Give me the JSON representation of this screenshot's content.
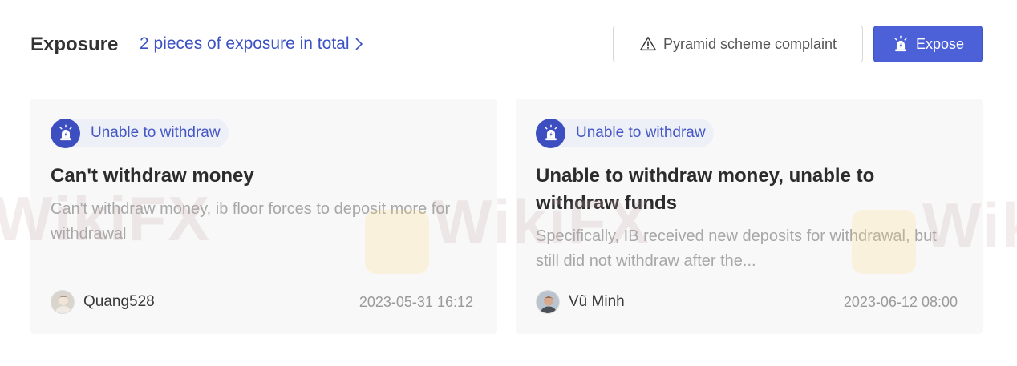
{
  "header": {
    "title": "Exposure",
    "total_link": "2 pieces of exposure in total",
    "complaint_button": "Pyramid scheme complaint",
    "expose_button": "Expose"
  },
  "watermark": {
    "text_left": "WikiFX",
    "text_center": "WikiFX",
    "text_right": "Wik"
  },
  "cards": [
    {
      "tag": "Unable to withdraw",
      "title": "Can't withdraw money",
      "description": "Can't withdraw money, ib floor forces to deposit more for withdrawal",
      "user": "Quang528",
      "date": "2023-05-31 16:12"
    },
    {
      "tag": "Unable to withdraw",
      "title": "Unable to withdraw money, unable to withdraw funds",
      "description": "Specifically, IB received new deposits for withdrawal, but still did not withdraw after the...",
      "user": "Vũ Minh",
      "date": "2023-06-12 08:00"
    }
  ],
  "colors": {
    "accent": "#4c61d7",
    "link": "#3b51c4",
    "tag_bg": "#eef0f7",
    "card_bg": "#f8f8f9"
  },
  "icons": {
    "total_link": "chevron-right-icon",
    "complaint": "warning-triangle-icon",
    "expose": "alarm-siren-icon",
    "tag": "alarm-siren-icon"
  }
}
